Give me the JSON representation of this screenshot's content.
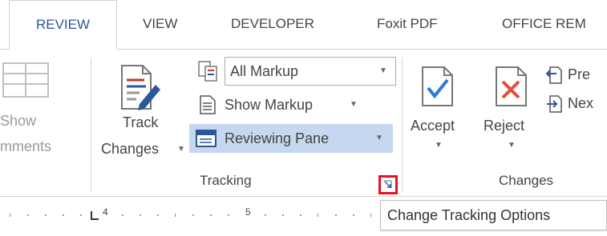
{
  "tabs": [
    {
      "label": "REVIEW",
      "active": true
    },
    {
      "label": "VIEW"
    },
    {
      "label": "DEVELOPER"
    },
    {
      "label": "Foxit PDF"
    },
    {
      "label": "OFFICE REM"
    }
  ],
  "comments": {
    "show_label_line1": "Show",
    "show_label_line2": "mments"
  },
  "tracking": {
    "track_changes_line1": "Track",
    "track_changes_line2": "Changes",
    "all_markup": "All Markup",
    "show_markup": "Show Markup",
    "reviewing_pane": "Reviewing Pane",
    "group_label": "Tracking"
  },
  "changes": {
    "accept": "Accept",
    "reject": "Reject",
    "previous": "Pre",
    "next": "Nex",
    "group_label": "Changes"
  },
  "ruler": {
    "marks": [
      "4",
      "5"
    ]
  },
  "tooltip": {
    "text": "Change Tracking Options"
  },
  "colors": {
    "accent": "#2b579a",
    "highlight": "#c5d8ef",
    "callout": "#e81123"
  },
  "icons": {
    "show_comments": "comments-icon",
    "track_changes": "track-changes-icon",
    "display_for_review": "display-for-review-icon",
    "show_markup": "show-markup-icon",
    "reviewing_pane": "reviewing-pane-icon",
    "accept": "accept-icon",
    "reject": "reject-icon",
    "previous": "previous-change-icon",
    "next": "next-change-icon",
    "launcher": "dialog-launcher-icon"
  }
}
